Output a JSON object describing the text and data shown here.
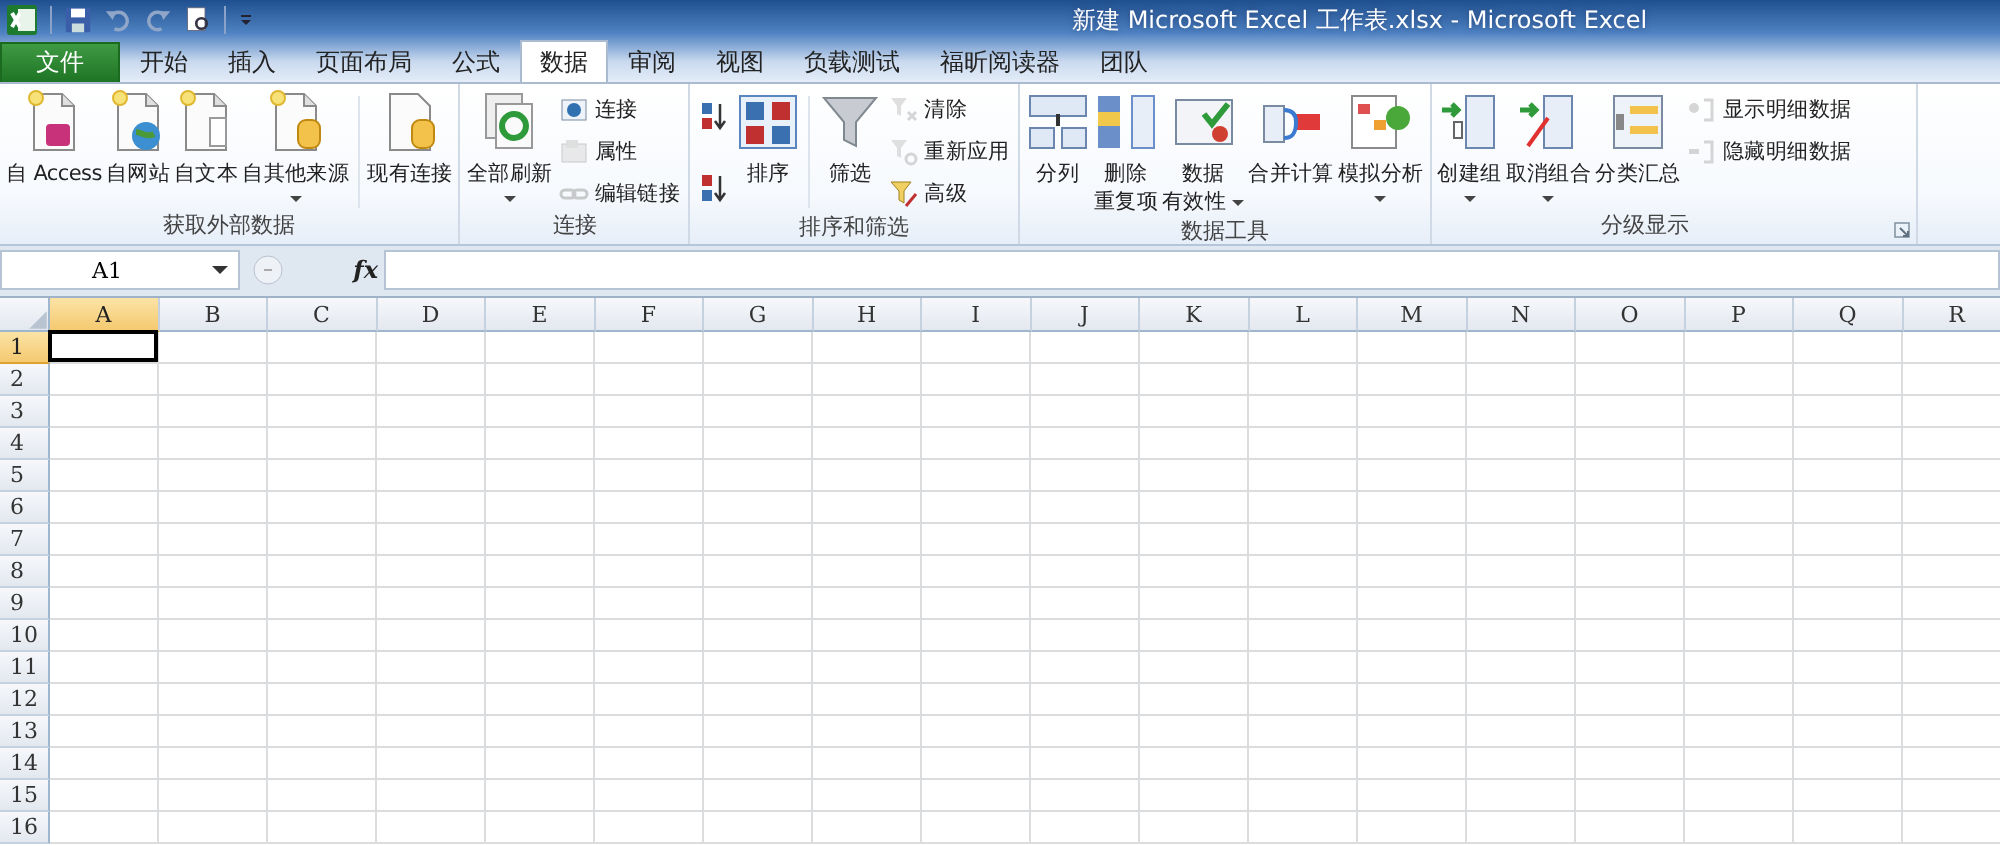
{
  "window": {
    "title": "新建 Microsoft Excel 工作表.xlsx - Microsoft Excel"
  },
  "tabs": [
    {
      "label": "文件",
      "kind": "file",
      "selected": false
    },
    {
      "label": "开始",
      "kind": "tab",
      "selected": false
    },
    {
      "label": "插入",
      "kind": "tab",
      "selected": false
    },
    {
      "label": "页面布局",
      "kind": "tab",
      "selected": false
    },
    {
      "label": "公式",
      "kind": "tab",
      "selected": false
    },
    {
      "label": "数据",
      "kind": "tab",
      "selected": true
    },
    {
      "label": "审阅",
      "kind": "tab",
      "selected": false
    },
    {
      "label": "视图",
      "kind": "tab",
      "selected": false
    },
    {
      "label": "负载测试",
      "kind": "tab",
      "selected": false
    },
    {
      "label": "福昕阅读器",
      "kind": "tab",
      "selected": false
    },
    {
      "label": "团队",
      "kind": "tab",
      "selected": false
    }
  ],
  "ribbon": {
    "groups": [
      {
        "label": "获取外部数据",
        "launcher": false,
        "items": [
          {
            "kind": "large",
            "lines": [
              "自 Access"
            ],
            "disabled": false,
            "dropdown": false
          },
          {
            "kind": "large",
            "lines": [
              "自网站"
            ],
            "disabled": false,
            "dropdown": false
          },
          {
            "kind": "large",
            "lines": [
              "自文本"
            ],
            "disabled": false,
            "dropdown": false
          },
          {
            "kind": "large",
            "lines": [
              "自其他来源"
            ],
            "disabled": false,
            "dropdown": true
          },
          {
            "kind": "separator"
          },
          {
            "kind": "large",
            "lines": [
              "现有连接"
            ],
            "disabled": false,
            "dropdown": false
          }
        ]
      },
      {
        "label": "连接",
        "launcher": false,
        "items": [
          {
            "kind": "large",
            "lines": [
              "全部刷新"
            ],
            "disabled": false,
            "dropdown": true
          },
          {
            "kind": "stack",
            "buttons": [
              {
                "label": "连接",
                "disabled": false
              },
              {
                "label": "属性",
                "disabled": true
              },
              {
                "label": "编辑链接",
                "disabled": true
              }
            ]
          }
        ]
      },
      {
        "label": "排序和筛选",
        "launcher": false,
        "items": [
          {
            "kind": "stack",
            "buttons": [
              {
                "disabled": false
              },
              {
                "disabled": false
              }
            ]
          },
          {
            "kind": "large",
            "lines": [
              "排序"
            ],
            "disabled": false,
            "dropdown": false
          },
          {
            "kind": "separator"
          },
          {
            "kind": "large",
            "lines": [
              "筛选"
            ],
            "disabled": false,
            "dropdown": false
          },
          {
            "kind": "stack",
            "buttons": [
              {
                "label": "清除",
                "disabled": true
              },
              {
                "label": "重新应用",
                "disabled": true
              },
              {
                "label": "高级",
                "disabled": false
              }
            ]
          }
        ]
      },
      {
        "label": "数据工具",
        "launcher": false,
        "items": [
          {
            "kind": "large",
            "lines": [
              "分列"
            ],
            "disabled": false,
            "dropdown": false
          },
          {
            "kind": "large",
            "lines": [
              "删除",
              "重复项"
            ],
            "disabled": false,
            "dropdown": false
          },
          {
            "kind": "large",
            "lines": [
              "数据",
              "有效性"
            ],
            "disabled": false,
            "dropdown": true
          },
          {
            "kind": "large",
            "lines": [
              "合并计算"
            ],
            "disabled": false,
            "dropdown": false
          },
          {
            "kind": "large",
            "lines": [
              "模拟分析"
            ],
            "disabled": false,
            "dropdown": true
          }
        ]
      },
      {
        "label": "分级显示",
        "launcher": true,
        "items": [
          {
            "kind": "large",
            "lines": [
              "创建组"
            ],
            "disabled": false,
            "dropdown": true
          },
          {
            "kind": "large",
            "lines": [
              "取消组合"
            ],
            "disabled": false,
            "dropdown": true
          },
          {
            "kind": "large",
            "lines": [
              "分类汇总"
            ],
            "disabled": false,
            "dropdown": false
          },
          {
            "kind": "stack",
            "buttons": [
              {
                "label": "显示明细数据",
                "disabled": true
              },
              {
                "label": "隐藏明细数据",
                "disabled": true
              }
            ]
          }
        ]
      }
    ]
  },
  "formula_bar": {
    "name_box": "A1",
    "function_label": "fx"
  },
  "sheet": {
    "columns": [
      {
        "label": "A",
        "selected": true
      },
      {
        "label": "B",
        "selected": false
      },
      {
        "label": "C",
        "selected": false
      },
      {
        "label": "D",
        "selected": false
      },
      {
        "label": "E",
        "selected": false
      },
      {
        "label": "F",
        "selected": false
      },
      {
        "label": "G",
        "selected": false
      },
      {
        "label": "H",
        "selected": false
      },
      {
        "label": "I",
        "selected": false
      },
      {
        "label": "J",
        "selected": false
      },
      {
        "label": "K",
        "selected": false
      },
      {
        "label": "L",
        "selected": false
      },
      {
        "label": "M",
        "selected": false
      },
      {
        "label": "N",
        "selected": false
      },
      {
        "label": "O",
        "selected": false
      },
      {
        "label": "P",
        "selected": false
      },
      {
        "label": "Q",
        "selected": false
      },
      {
        "label": "R",
        "selected": false
      }
    ],
    "rows": [
      {
        "label": "1",
        "selected": true
      },
      {
        "label": "2",
        "selected": false
      },
      {
        "label": "3",
        "selected": false
      },
      {
        "label": "4",
        "selected": false
      },
      {
        "label": "5",
        "selected": false
      },
      {
        "label": "6",
        "selected": false
      },
      {
        "label": "7",
        "selected": false
      },
      {
        "label": "8",
        "selected": false
      },
      {
        "label": "9",
        "selected": false
      },
      {
        "label": "10",
        "selected": false
      },
      {
        "label": "11",
        "selected": false
      },
      {
        "label": "12",
        "selected": false
      },
      {
        "label": "13",
        "selected": false
      },
      {
        "label": "14",
        "selected": false
      },
      {
        "label": "15",
        "selected": false
      },
      {
        "label": "16",
        "selected": false
      }
    ]
  }
}
